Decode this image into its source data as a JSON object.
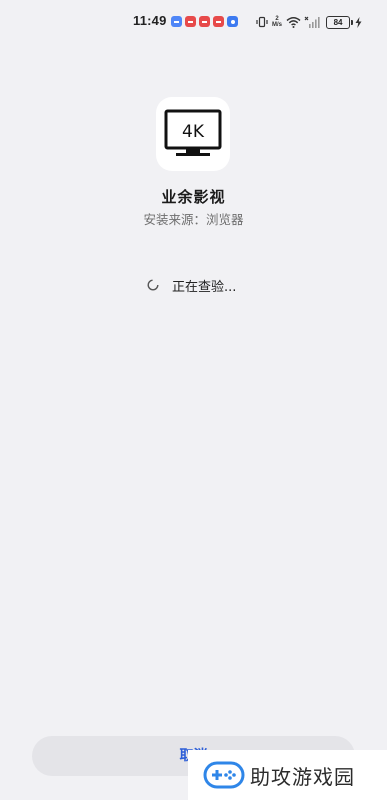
{
  "status_bar": {
    "time": "11:49",
    "speed_value": "2",
    "speed_unit": "M/s",
    "battery": "84",
    "notification_icons": [
      "blue-app-icon",
      "red-app-icon",
      "red-app-icon",
      "red-app-icon",
      "blue-app-icon"
    ]
  },
  "app": {
    "icon_text": "4K",
    "name": "业余影视",
    "install_source_label": "安装来源：",
    "install_source_value": "浏览器"
  },
  "status": {
    "checking_text": "正在查验..."
  },
  "actions": {
    "cancel_label": "取消"
  },
  "watermark": {
    "text": "助攻游戏园"
  },
  "colors": {
    "background": "#f1f1f4",
    "accent": "#2d5fd8",
    "button_bg": "#e4e4e8"
  }
}
